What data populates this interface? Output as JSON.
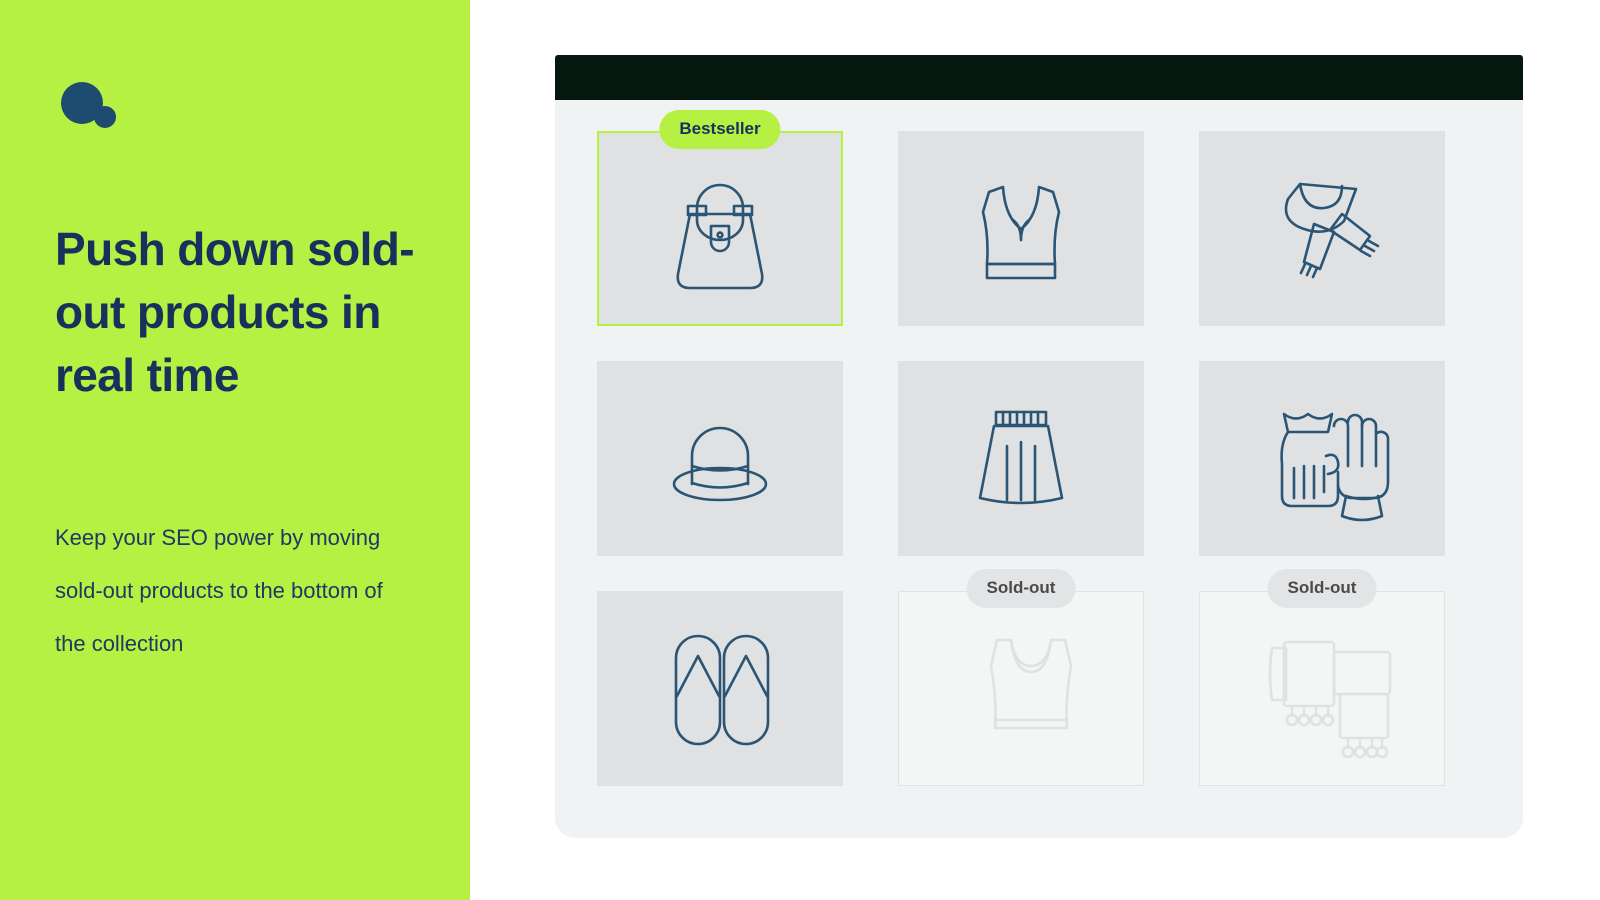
{
  "brand": {
    "logo_icon": "two-circles-logo",
    "logo_color": "#1e4c71"
  },
  "colors": {
    "accent_green": "#b6f043",
    "navy_text": "#17305c",
    "icon_stroke": "#2a5575",
    "card_bg": "#e0e1e2",
    "panel_bg": "#f1f2f3",
    "chrome_bar": "#061710",
    "soldout_badge_bg": "#e3e4e5",
    "soldout_badge_text": "#4a4a4a"
  },
  "left_panel": {
    "headline": "Push down sold-out products in real time",
    "subcopy": "Keep your SEO power by moving sold-out products to the bottom of the collection"
  },
  "browser": {
    "chrome_bar_label": ""
  },
  "product_grid": {
    "columns": 3,
    "rows": 3,
    "products": [
      {
        "id": "handbag",
        "icon": "handbag-icon",
        "badge": "Bestseller",
        "badge_type": "bestseller",
        "state": "highlighted",
        "available": true
      },
      {
        "id": "crop-top",
        "icon": "crop-top-icon",
        "badge": "",
        "badge_type": "",
        "state": "normal",
        "available": true
      },
      {
        "id": "scarf",
        "icon": "scarf-icon",
        "badge": "",
        "badge_type": "",
        "state": "normal",
        "available": true
      },
      {
        "id": "hat",
        "icon": "bowler-hat-icon",
        "badge": "",
        "badge_type": "",
        "state": "normal",
        "available": true
      },
      {
        "id": "skirt",
        "icon": "skirt-icon",
        "badge": "",
        "badge_type": "",
        "state": "normal",
        "available": true
      },
      {
        "id": "gloves",
        "icon": "gloves-icon",
        "badge": "",
        "badge_type": "",
        "state": "normal",
        "available": true
      },
      {
        "id": "flipflops",
        "icon": "flip-flops-icon",
        "badge": "",
        "badge_type": "",
        "state": "normal",
        "available": true
      },
      {
        "id": "tank-top",
        "icon": "tank-top-icon",
        "badge": "Sold-out",
        "badge_type": "soldout",
        "state": "soldout",
        "available": false
      },
      {
        "id": "blankets",
        "icon": "blankets-icon",
        "badge": "Sold-out",
        "badge_type": "soldout",
        "state": "soldout",
        "available": false
      }
    ]
  }
}
